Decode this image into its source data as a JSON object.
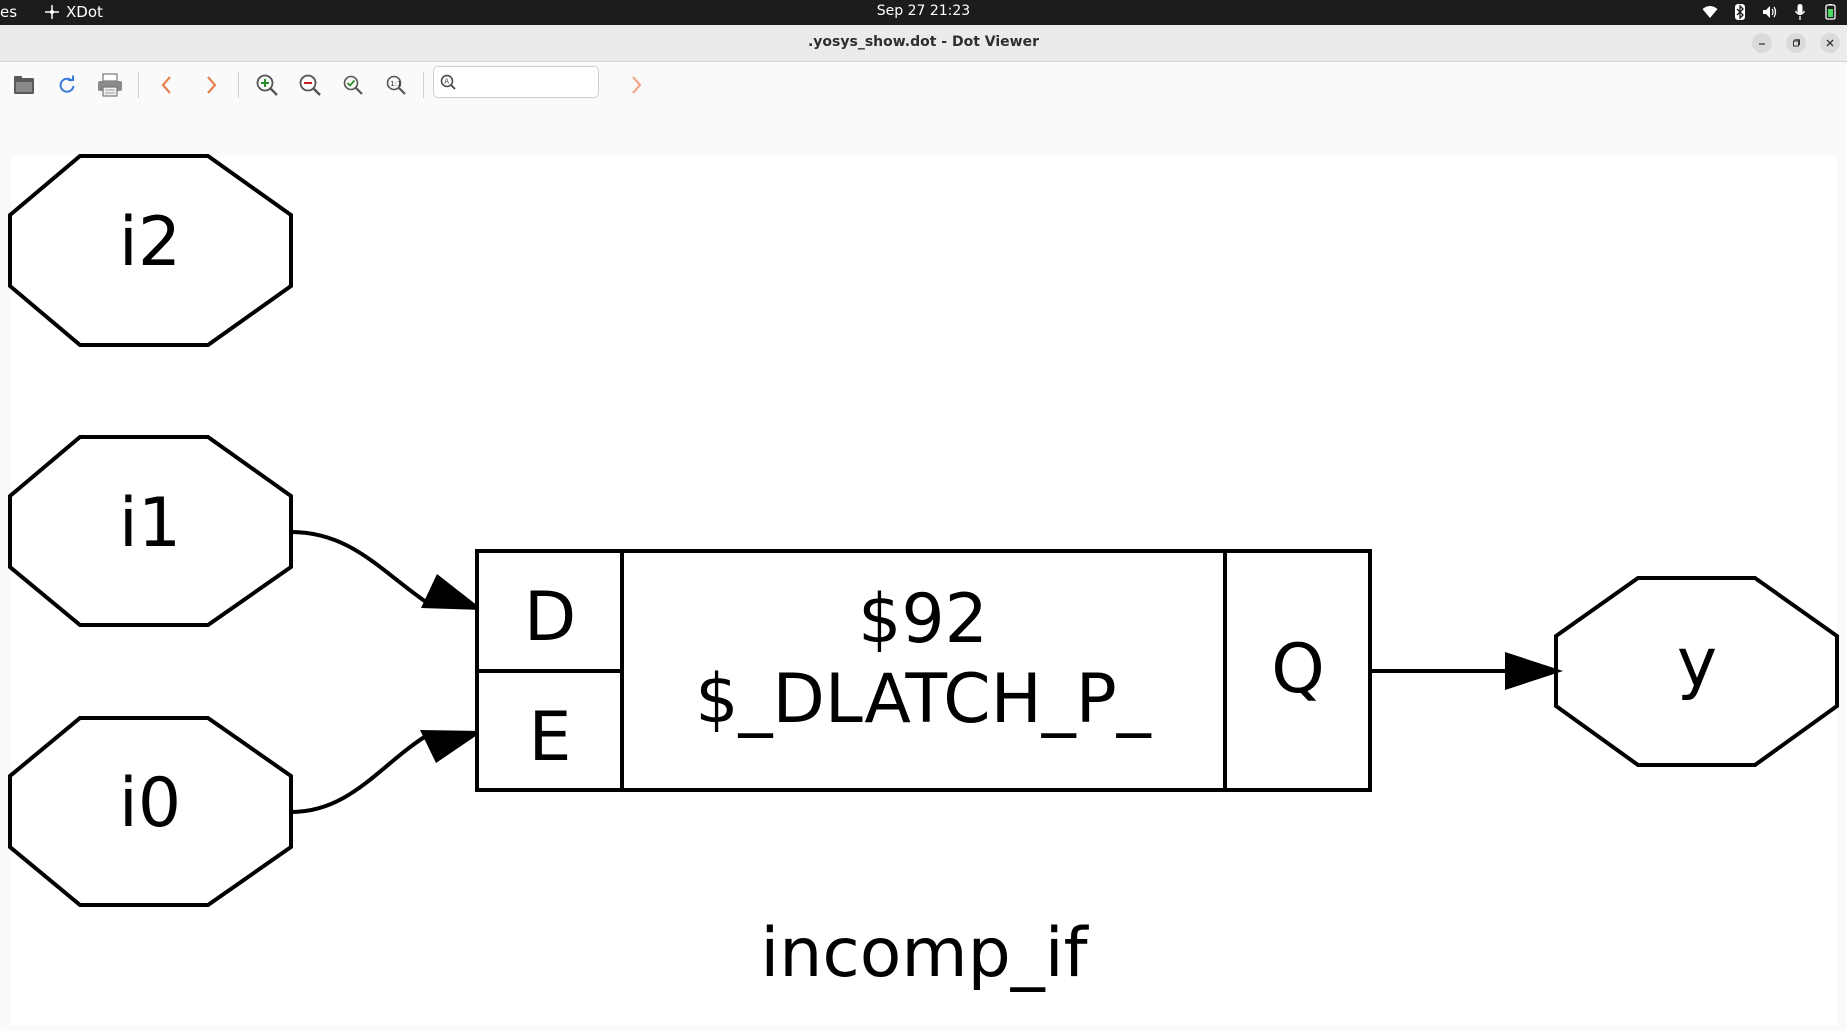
{
  "topbar": {
    "activities_label": "es",
    "app_name": "XDot",
    "clock": "Sep 27  21:23",
    "tray_icons": [
      "wifi-icon",
      "bluetooth-icon",
      "volume-icon",
      "microphone-icon",
      "battery-icon"
    ]
  },
  "window": {
    "title": ".yosys_show.dot - Dot Viewer",
    "controls": [
      "minimize",
      "restore",
      "close"
    ]
  },
  "toolbar": {
    "buttons": [
      "open-icon",
      "reload-icon",
      "print-icon",
      "back-icon",
      "forward-icon",
      "zoom-in-icon",
      "zoom-out-icon",
      "zoom-fit-icon",
      "zoom-100-icon",
      "find-next-icon"
    ],
    "search_value": ""
  },
  "graph": {
    "name": "incomp_if",
    "inputs": [
      "i2",
      "i1",
      "i0"
    ],
    "output": "y",
    "cell": {
      "id": "$92",
      "type": "$_DLATCH_P_",
      "in_ports": [
        "D",
        "E"
      ],
      "out_port": "Q"
    },
    "edges": [
      {
        "from": "i1",
        "to": "D"
      },
      {
        "from": "i0",
        "to": "E"
      },
      {
        "from": "Q",
        "to": "y"
      }
    ]
  },
  "colors": {
    "topbar_bg": "#1c1c1c",
    "titlebar_bg": "#ebebeb",
    "canvas_bg": "#ffffff",
    "stroke": "#000000",
    "nav_arrow": "#e8804e",
    "zoom_in_plus": "#2a8f2a",
    "zoom_out_minus": "#c82020",
    "reload": "#3a7bd5"
  }
}
